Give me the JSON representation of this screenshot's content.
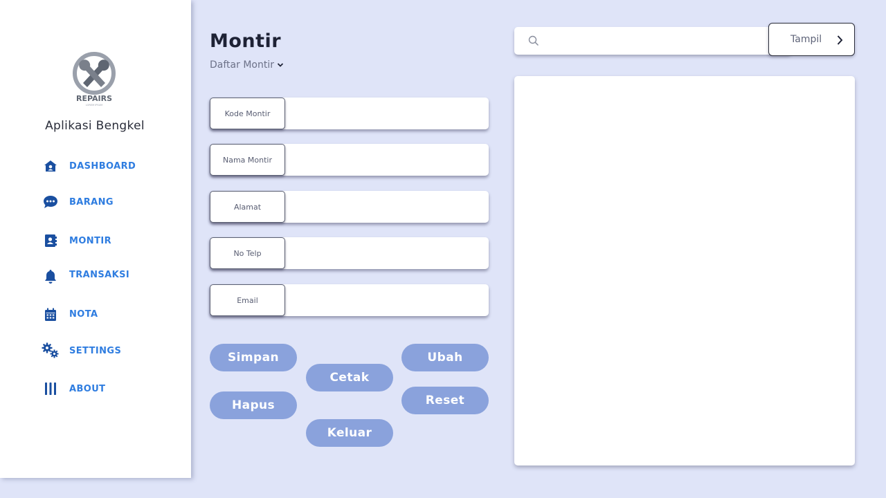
{
  "app": {
    "name": "Aplikasi Bengkel",
    "logo_text": "REPAIRS",
    "logo_tagline": "LOREM IPSUM"
  },
  "sidebar": {
    "items": [
      {
        "label": "DASHBOARD",
        "icon": "house-user-icon"
      },
      {
        "label": "BARANG",
        "icon": "comment-dots-icon"
      },
      {
        "label": "MONTIR",
        "icon": "address-book-icon"
      },
      {
        "label": "TRANSAKSI",
        "icon": "bell-icon"
      },
      {
        "label": "NOTA",
        "icon": "calendar-icon"
      },
      {
        "label": "SETTINGS",
        "icon": "gears-icon"
      },
      {
        "label": "ABOUT",
        "icon": "bars-vertical-icon"
      }
    ]
  },
  "page": {
    "title": "Montir",
    "subtitle": "Daftar Montir"
  },
  "form": {
    "fields": [
      {
        "label": "Kode Montir",
        "value": ""
      },
      {
        "label": "Nama Montir",
        "value": ""
      },
      {
        "label": "Alamat",
        "value": ""
      },
      {
        "label": "No Telp",
        "value": ""
      },
      {
        "label": "Email",
        "value": ""
      }
    ]
  },
  "buttons": {
    "simpan": "Simpan",
    "hapus": "Hapus",
    "cetak": "Cetak",
    "keluar": "Keluar",
    "ubah": "Ubah",
    "reset": "Reset"
  },
  "search": {
    "value": "",
    "button_label": "Tampil"
  },
  "colors": {
    "background": "#dfe4f8",
    "nav_label": "#2f7de0",
    "nav_icon": "#1a4fa0",
    "button": "#8aa2dc"
  }
}
